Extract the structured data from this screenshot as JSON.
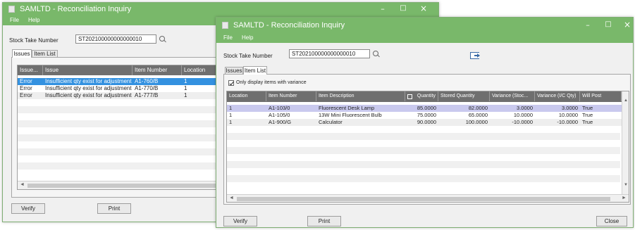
{
  "back_window": {
    "title": "SAMLTD - Reconciliation Inquiry",
    "menu": [
      "File",
      "Help"
    ],
    "stock_take_label": "Stock Take Number",
    "stock_take_value": "ST202100000000000010",
    "tabs": [
      "Issues",
      "Item List"
    ],
    "issues_grid": {
      "headers": [
        "Issue...",
        "Issue",
        "Item Number",
        "Location"
      ],
      "rows": [
        [
          "Error",
          "Insufficient qty exist for adjustment",
          "A1-760/B",
          "1"
        ],
        [
          "Error",
          "Insufficient qty exist for adjustment",
          "A1-770/B",
          "1"
        ],
        [
          "Error",
          "Insufficient qty exist for adjustment",
          "A1-777/B",
          "1"
        ]
      ]
    },
    "verify_label": "Verify",
    "print_label": "Print"
  },
  "front_window": {
    "title": "SAMLTD - Reconciliation Inquiry",
    "menu": [
      "File",
      "Help"
    ],
    "stock_take_label": "Stock Take Number",
    "stock_take_value": "ST202100000000000010",
    "tabs": [
      "Issues",
      "Item List"
    ],
    "only_variance_label": "Only display items with variance",
    "items_grid": {
      "headers": [
        "Location",
        "Item Number",
        "Item Description",
        "Quantity",
        "Stored Quantity",
        "Variance (Stoc...",
        "Variance (I/C Qty)",
        "Will Post"
      ],
      "rows": [
        [
          "1",
          "A1-103/0",
          "Fluorescent Desk Lamp",
          "85.0000",
          "82.0000",
          "3.0000",
          "3.0000",
          "True"
        ],
        [
          "1",
          "A1-105/0",
          "13W Mini Fluorescent Bulb",
          "75.0000",
          "65.0000",
          "10.0000",
          "10.0000",
          "True"
        ],
        [
          "1",
          "A1-900/G",
          "Calculator",
          "90.0000",
          "100.0000",
          "-10.0000",
          "-10.0000",
          "True"
        ]
      ]
    },
    "verify_label": "Verify",
    "print_label": "Print",
    "close_label": "Close"
  },
  "icons": {
    "minimize": "–",
    "maximize": "□",
    "close": "×",
    "scroll_up": "▲",
    "scroll_down": "▼",
    "scroll_left": "◄",
    "scroll_right": "►"
  },
  "colors": {
    "titlebar": "#79b86a",
    "selected_row": "#3391e0",
    "grid_header": "#6f6f6f"
  }
}
